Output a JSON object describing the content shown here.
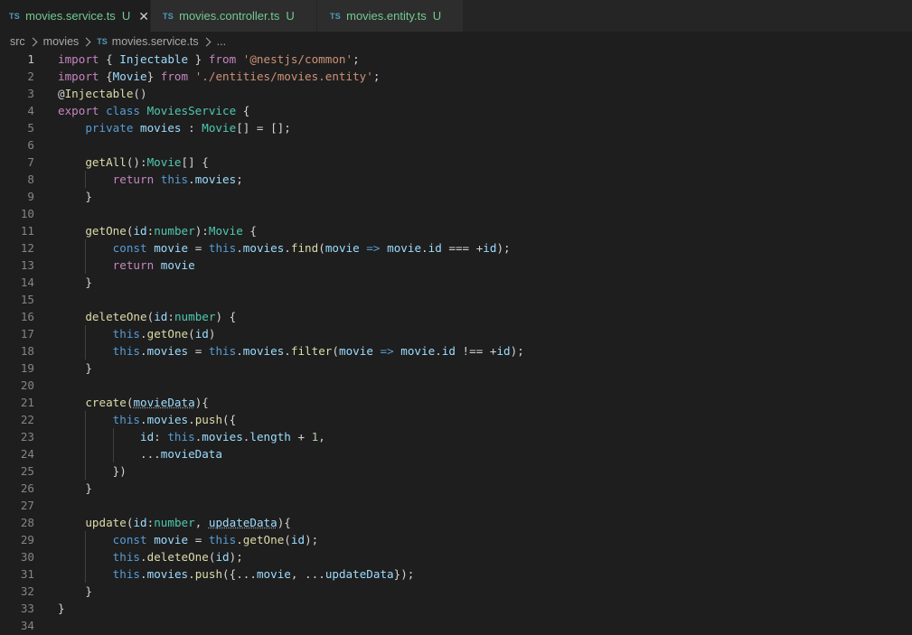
{
  "tabs": [
    {
      "icon": "TS",
      "label": "movies.service.ts",
      "modified": "U",
      "active": true
    },
    {
      "icon": "TS",
      "label": "movies.controller.ts",
      "modified": "U",
      "active": false
    },
    {
      "icon": "TS",
      "label": "movies.entity.ts",
      "modified": "U",
      "active": false
    }
  ],
  "breadcrumb": {
    "parts": [
      "src",
      "movies"
    ],
    "file_icon": "TS",
    "file": "movies.service.ts",
    "more": "..."
  },
  "code": {
    "current_line": 1,
    "lines": [
      [
        [
          "kw",
          "import"
        ],
        [
          "pu",
          " { "
        ],
        [
          "va",
          "Injectable"
        ],
        [
          "pu",
          " } "
        ],
        [
          "kw",
          "from"
        ],
        [
          "pu",
          " "
        ],
        [
          "st",
          "'@nestjs/common'"
        ],
        [
          "pu",
          ";"
        ]
      ],
      [
        [
          "kw",
          "import"
        ],
        [
          "pu",
          " {"
        ],
        [
          "va",
          "Movie"
        ],
        [
          "pu",
          "} "
        ],
        [
          "kw",
          "from"
        ],
        [
          "pu",
          " "
        ],
        [
          "st",
          "'./entities/movies.entity'"
        ],
        [
          "pu",
          ";"
        ]
      ],
      [
        [
          "pu",
          "@"
        ],
        [
          "fn",
          "Injectable"
        ],
        [
          "pu",
          "()"
        ]
      ],
      [
        [
          "kw",
          "export"
        ],
        [
          "pu",
          " "
        ],
        [
          "bl",
          "class"
        ],
        [
          "pu",
          " "
        ],
        [
          "ty",
          "MoviesService"
        ],
        [
          "pu",
          " {"
        ]
      ],
      [
        [
          "pu",
          "    "
        ],
        [
          "bl",
          "private"
        ],
        [
          "pu",
          " "
        ],
        [
          "va",
          "movies"
        ],
        [
          "pu",
          " : "
        ],
        [
          "ty",
          "Movie"
        ],
        [
          "pu",
          "[] = [];"
        ]
      ],
      [],
      [
        [
          "pu",
          "    "
        ],
        [
          "fn",
          "getAll"
        ],
        [
          "pu",
          "():"
        ],
        [
          "ty",
          "Movie"
        ],
        [
          "pu",
          "[] {"
        ]
      ],
      [
        [
          "pu",
          "        "
        ],
        [
          "kw",
          "return"
        ],
        [
          "pu",
          " "
        ],
        [
          "bl",
          "this"
        ],
        [
          "pu",
          "."
        ],
        [
          "va",
          "movies"
        ],
        [
          "pu",
          ";"
        ]
      ],
      [
        [
          "pu",
          "    }"
        ]
      ],
      [],
      [
        [
          "pu",
          "    "
        ],
        [
          "fn",
          "getOne"
        ],
        [
          "pu",
          "("
        ],
        [
          "va",
          "id"
        ],
        [
          "pu",
          ":"
        ],
        [
          "ty",
          "number"
        ],
        [
          "pu",
          "):"
        ],
        [
          "ty",
          "Movie"
        ],
        [
          "pu",
          " {"
        ]
      ],
      [
        [
          "pu",
          "        "
        ],
        [
          "bl",
          "const"
        ],
        [
          "pu",
          " "
        ],
        [
          "va",
          "movie"
        ],
        [
          "pu",
          " = "
        ],
        [
          "bl",
          "this"
        ],
        [
          "pu",
          "."
        ],
        [
          "va",
          "movies"
        ],
        [
          "pu",
          "."
        ],
        [
          "fn",
          "find"
        ],
        [
          "pu",
          "("
        ],
        [
          "va",
          "movie"
        ],
        [
          "pu",
          " "
        ],
        [
          "bl",
          "=>"
        ],
        [
          "pu",
          " "
        ],
        [
          "va",
          "movie"
        ],
        [
          "pu",
          "."
        ],
        [
          "va",
          "id"
        ],
        [
          "pu",
          " === +"
        ],
        [
          "va",
          "id"
        ],
        [
          "pu",
          ");"
        ]
      ],
      [
        [
          "pu",
          "        "
        ],
        [
          "kw",
          "return"
        ],
        [
          "pu",
          " "
        ],
        [
          "va",
          "movie"
        ]
      ],
      [
        [
          "pu",
          "    }"
        ]
      ],
      [],
      [
        [
          "pu",
          "    "
        ],
        [
          "fn",
          "deleteOne"
        ],
        [
          "pu",
          "("
        ],
        [
          "va",
          "id"
        ],
        [
          "pu",
          ":"
        ],
        [
          "ty",
          "number"
        ],
        [
          "pu",
          ") {"
        ]
      ],
      [
        [
          "pu",
          "        "
        ],
        [
          "bl",
          "this"
        ],
        [
          "pu",
          "."
        ],
        [
          "fn",
          "getOne"
        ],
        [
          "pu",
          "("
        ],
        [
          "va",
          "id"
        ],
        [
          "pu",
          ")"
        ]
      ],
      [
        [
          "pu",
          "        "
        ],
        [
          "bl",
          "this"
        ],
        [
          "pu",
          "."
        ],
        [
          "va",
          "movies"
        ],
        [
          "pu",
          " = "
        ],
        [
          "bl",
          "this"
        ],
        [
          "pu",
          "."
        ],
        [
          "va",
          "movies"
        ],
        [
          "pu",
          "."
        ],
        [
          "fn",
          "filter"
        ],
        [
          "pu",
          "("
        ],
        [
          "va",
          "movie"
        ],
        [
          "pu",
          " "
        ],
        [
          "bl",
          "=>"
        ],
        [
          "pu",
          " "
        ],
        [
          "va",
          "movie"
        ],
        [
          "pu",
          "."
        ],
        [
          "va",
          "id"
        ],
        [
          "pu",
          " !== +"
        ],
        [
          "va",
          "id"
        ],
        [
          "pu",
          ");"
        ]
      ],
      [
        [
          "pu",
          "    }"
        ]
      ],
      [],
      [
        [
          "pu",
          "    "
        ],
        [
          "fn",
          "create"
        ],
        [
          "pu",
          "("
        ],
        [
          "va sq",
          "movieData"
        ],
        [
          "pu",
          "){"
        ]
      ],
      [
        [
          "pu",
          "        "
        ],
        [
          "bl",
          "this"
        ],
        [
          "pu",
          "."
        ],
        [
          "va",
          "movies"
        ],
        [
          "pu",
          "."
        ],
        [
          "fn",
          "push"
        ],
        [
          "pu",
          "({"
        ]
      ],
      [
        [
          "pu",
          "            "
        ],
        [
          "va",
          "id"
        ],
        [
          "pu",
          ": "
        ],
        [
          "bl",
          "this"
        ],
        [
          "pu",
          "."
        ],
        [
          "va",
          "movies"
        ],
        [
          "pu",
          "."
        ],
        [
          "va",
          "length"
        ],
        [
          "pu",
          " + "
        ],
        [
          "nu",
          "1"
        ],
        [
          "pu",
          ","
        ]
      ],
      [
        [
          "pu",
          "            ..."
        ],
        [
          "va",
          "movieData"
        ]
      ],
      [
        [
          "pu",
          "        })"
        ]
      ],
      [
        [
          "pu",
          "    }"
        ]
      ],
      [],
      [
        [
          "pu",
          "    "
        ],
        [
          "fn",
          "update"
        ],
        [
          "pu",
          "("
        ],
        [
          "va",
          "id"
        ],
        [
          "pu",
          ":"
        ],
        [
          "ty",
          "number"
        ],
        [
          "pu",
          ", "
        ],
        [
          "va sq",
          "updateData"
        ],
        [
          "pu",
          "){"
        ]
      ],
      [
        [
          "pu",
          "        "
        ],
        [
          "bl",
          "const"
        ],
        [
          "pu",
          " "
        ],
        [
          "va",
          "movie"
        ],
        [
          "pu",
          " = "
        ],
        [
          "bl",
          "this"
        ],
        [
          "pu",
          "."
        ],
        [
          "fn",
          "getOne"
        ],
        [
          "pu",
          "("
        ],
        [
          "va",
          "id"
        ],
        [
          "pu",
          ");"
        ]
      ],
      [
        [
          "pu",
          "        "
        ],
        [
          "bl",
          "this"
        ],
        [
          "pu",
          "."
        ],
        [
          "fn",
          "deleteOne"
        ],
        [
          "pu",
          "("
        ],
        [
          "va",
          "id"
        ],
        [
          "pu",
          ");"
        ]
      ],
      [
        [
          "pu",
          "        "
        ],
        [
          "bl",
          "this"
        ],
        [
          "pu",
          "."
        ],
        [
          "va",
          "movies"
        ],
        [
          "pu",
          "."
        ],
        [
          "fn",
          "push"
        ],
        [
          "pu",
          "({..."
        ],
        [
          "va",
          "movie"
        ],
        [
          "pu",
          ", ..."
        ],
        [
          "va",
          "updateData"
        ],
        [
          "pu",
          "});"
        ]
      ],
      [
        [
          "pu",
          "    }"
        ]
      ],
      [
        [
          "pu",
          "}"
        ]
      ],
      []
    ]
  }
}
